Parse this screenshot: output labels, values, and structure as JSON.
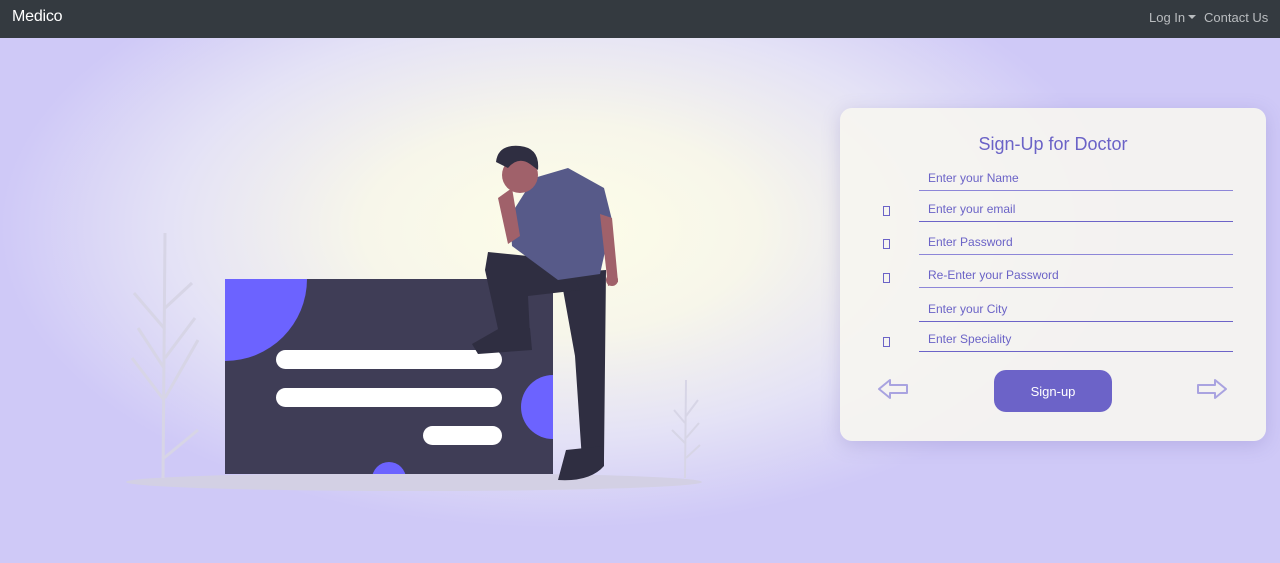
{
  "navbar": {
    "brand": "Medico",
    "login_label": "Log In",
    "contact_label": "Contact Us"
  },
  "form": {
    "title": "Sign-Up for Doctor",
    "fields": [
      {
        "placeholder": "Enter your Name"
      },
      {
        "placeholder": "Enter your email"
      },
      {
        "placeholder": "Enter Password"
      },
      {
        "placeholder": "Re-Enter your Password"
      },
      {
        "placeholder": "Enter your City"
      },
      {
        "placeholder": "Enter Speciality"
      }
    ],
    "submit_label": "Sign-up"
  },
  "colors": {
    "accent": "#6c63ff",
    "navbar": "#343a40",
    "card_text": "#6b63c7"
  },
  "icons": [
    "caret-down-icon",
    "field-icon",
    "arrow-left-icon",
    "arrow-right-icon"
  ]
}
